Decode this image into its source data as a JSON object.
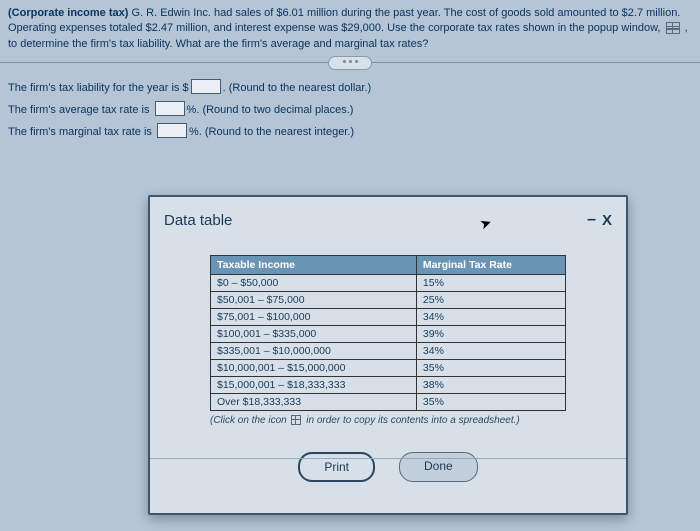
{
  "problem": {
    "title_bold": "(Corporate income tax)",
    "text_after_bold": " G. R. Edwin Inc. had sales of $6.01 million during the past year. The cost of goods sold amounted to $2.7 million. Operating expenses totaled $2.47 million, and interest expense was $29,000. Use the corporate tax rates shown in the popup window, ",
    "text_end": " , to determine the firm's tax liability. What are the firm's average and marginal tax rates?"
  },
  "answers": {
    "line1_pre": "The firm's tax liability for the year is $",
    "line1_post": ". (Round to the nearest dollar.)",
    "line2_pre": "The firm's average tax rate is ",
    "line2_post": "%. (Round to two decimal places.)",
    "line3_pre": "The firm's marginal tax rate is ",
    "line3_post": "%. (Round to the nearest integer.)"
  },
  "modal": {
    "title": "Data table",
    "minimize": "–",
    "close": "X",
    "headers": {
      "col1": "Taxable Income",
      "col2": "Marginal Tax Rate"
    },
    "rows": [
      {
        "range": "$0 – $50,000",
        "rate": "15%"
      },
      {
        "range": "$50,001 – $75,000",
        "rate": "25%"
      },
      {
        "range": "$75,001 – $100,000",
        "rate": "34%"
      },
      {
        "range": "$100,001 – $335,000",
        "rate": "39%"
      },
      {
        "range": "$335,001 – $10,000,000",
        "rate": "34%"
      },
      {
        "range": "$10,000,001 – $15,000,000",
        "rate": "35%"
      },
      {
        "range": "$15,000,001 – $18,333,333",
        "rate": "38%"
      },
      {
        "range": "Over $18,333,333",
        "rate": "35%"
      }
    ],
    "caption_pre": "(Click on the icon ",
    "caption_post": " in order to copy its contents into a spreadsheet.)",
    "print": "Print",
    "done": "Done"
  }
}
